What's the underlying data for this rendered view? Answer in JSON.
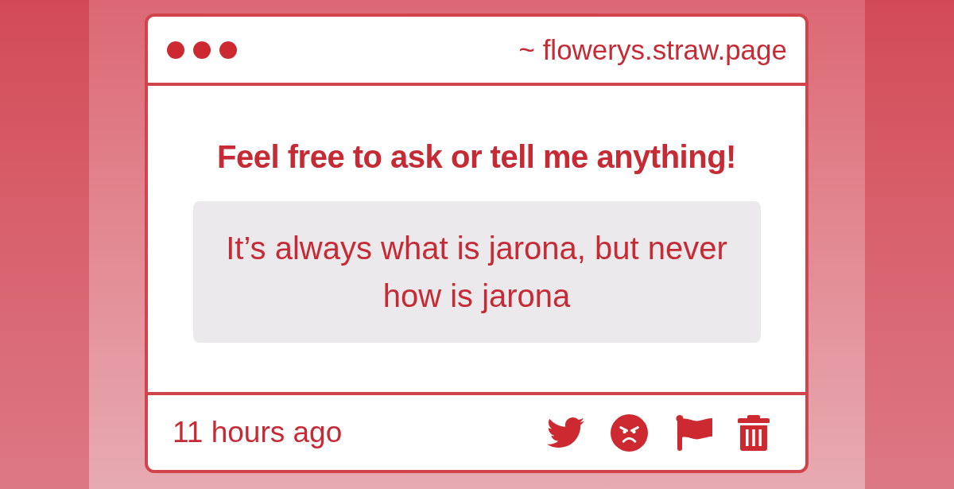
{
  "window": {
    "address": "~ flowerys.straw.page"
  },
  "prompt": "Feel free to ask or tell me anything!",
  "message": "It’s always what is jarona, but never how is jarona",
  "footer": {
    "time": "11 hours ago"
  }
}
